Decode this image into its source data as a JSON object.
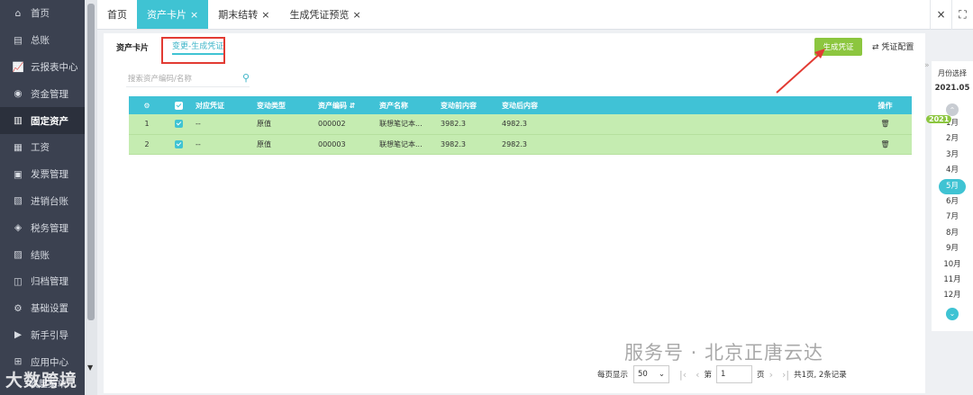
{
  "sidebar": {
    "items": [
      {
        "label": "首页",
        "icon": "home-icon"
      },
      {
        "label": "总账",
        "icon": "ledger-icon"
      },
      {
        "label": "云报表中心",
        "icon": "chart-icon"
      },
      {
        "label": "资金管理",
        "icon": "money-bag-icon"
      },
      {
        "label": "固定资产",
        "icon": "book-icon"
      },
      {
        "label": "工资",
        "icon": "salary-icon"
      },
      {
        "label": "发票管理",
        "icon": "invoice-icon"
      },
      {
        "label": "进销台账",
        "icon": "register-icon"
      },
      {
        "label": "税务管理",
        "icon": "tax-icon"
      },
      {
        "label": "结账",
        "icon": "close-book-icon"
      },
      {
        "label": "归档管理",
        "icon": "archive-icon"
      },
      {
        "label": "基础设置",
        "icon": "settings-icon"
      },
      {
        "label": "新手引导",
        "icon": "guide-icon"
      },
      {
        "label": "应用中心",
        "icon": "apps-icon"
      }
    ],
    "active_index": 4,
    "bottom_text": "收起菜单",
    "logo_watermark": "大数跨境"
  },
  "tabs": [
    {
      "label": "首页",
      "closable": false
    },
    {
      "label": "资产卡片",
      "closable": true,
      "active": true
    },
    {
      "label": "期末结转",
      "closable": true
    },
    {
      "label": "生成凭证预览",
      "closable": true
    }
  ],
  "tab_tools": {
    "close": "×",
    "fullscreen": "⛶"
  },
  "subtabs": {
    "card": "资产卡片",
    "change": "变更-生成凭证"
  },
  "actions": {
    "generate": "生成凭证",
    "config": "凭证配置"
  },
  "search": {
    "placeholder": "搜索资产编码/名称"
  },
  "table": {
    "headers": [
      "",
      "",
      "对应凭证",
      "变动类型",
      "资产编码",
      "资产名称",
      "变动前内容",
      "变动后内容",
      "操作"
    ],
    "rows": [
      {
        "index": "1",
        "voucher": "--",
        "type": "原值",
        "code": "000002",
        "name": "联想笔记本...",
        "before": "3982.3",
        "after": "4982.3"
      },
      {
        "index": "2",
        "voucher": "--",
        "type": "原值",
        "code": "000003",
        "name": "联想笔记本...",
        "before": "3982.3",
        "after": "2982.3"
      }
    ]
  },
  "pager": {
    "per_page_label": "每页显示",
    "per_page": "50",
    "page_prefix": "第",
    "page": "1",
    "page_suffix": "页",
    "summary": "共1页, 2条记录"
  },
  "watermark": "服务号 · 北京正唐云达",
  "month_panel": {
    "title": "月份选择",
    "current": "2021.05",
    "year_badge": "2021",
    "months": [
      "1月",
      "2月",
      "3月",
      "4月",
      "5月",
      "6月",
      "7月",
      "8月",
      "9月",
      "10月",
      "11月",
      "12月"
    ],
    "active_month": "5月"
  },
  "colors": {
    "accent": "#3fc3d3",
    "sidebar": "#3b4150",
    "button": "#8cc63f",
    "row": "#c5ecb1",
    "highlight": "#e23b33"
  }
}
